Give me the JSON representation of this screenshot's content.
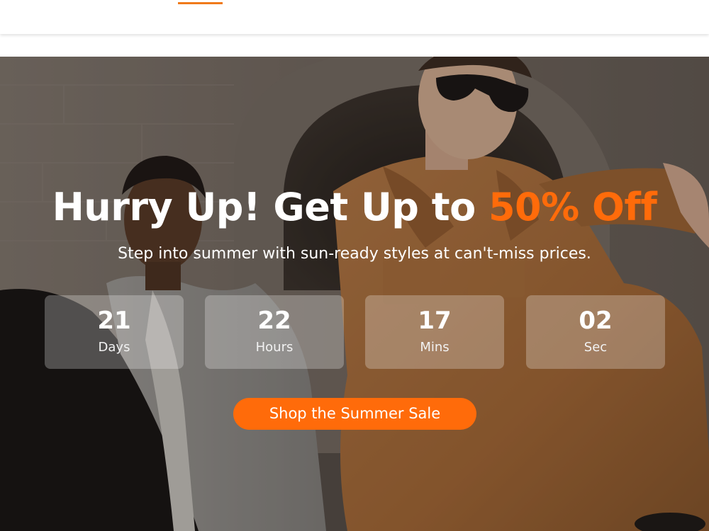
{
  "hero": {
    "headline_main": "Hurry Up! Get Up to ",
    "headline_accent": "50% Off",
    "subheadline": "Step into summer with sun-ready styles at can't-miss prices.",
    "countdown": [
      {
        "value": "21",
        "unit": "Days"
      },
      {
        "value": "22",
        "unit": "Hours"
      },
      {
        "value": "17",
        "unit": "Mins"
      },
      {
        "value": "02",
        "unit": "Sec"
      }
    ],
    "cta_label": "Shop the Summer Sale"
  },
  "colors": {
    "accent": "#ff6b0a",
    "nav_indicator": "#f07a1a",
    "text": "#ffffff"
  }
}
